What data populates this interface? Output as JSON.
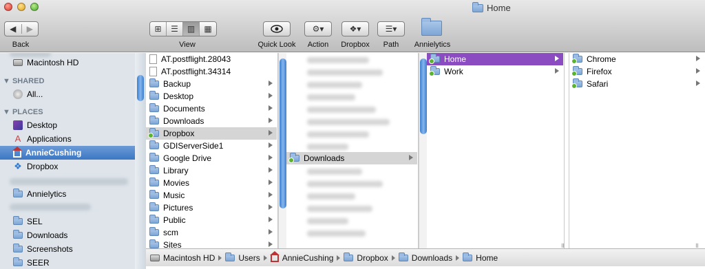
{
  "window": {
    "title": "Home"
  },
  "toolbar": {
    "back_label": "Back",
    "view_label": "View",
    "quicklook_label": "Quick Look",
    "action_label": "Action",
    "dropbox_label": "Dropbox",
    "path_label": "Path",
    "annielytics_label": "Annielytics"
  },
  "sidebar": {
    "devices": [
      {
        "label": "Macintosh HD",
        "icon": "hard-drive-icon"
      }
    ],
    "shared_heading": "SHARED",
    "shared": [
      {
        "label": "All...",
        "icon": "network-icon"
      }
    ],
    "places_heading": "PLACES",
    "places": [
      {
        "label": "Desktop",
        "icon": "desktop-icon"
      },
      {
        "label": "Applications",
        "icon": "applications-icon"
      },
      {
        "label": "AnnieCushing",
        "icon": "home-icon",
        "selected": true
      },
      {
        "label": "Dropbox",
        "icon": "dropbox-icon"
      }
    ],
    "folders": [
      {
        "label": "Annielytics"
      },
      {
        "label": "SEL"
      },
      {
        "label": "Downloads"
      },
      {
        "label": "Screenshots"
      },
      {
        "label": "SEER"
      }
    ]
  },
  "column1": [
    {
      "label": "AT.postflight.28043",
      "type": "file"
    },
    {
      "label": "AT.postflight.34314",
      "type": "file"
    },
    {
      "label": "Backup",
      "type": "folder"
    },
    {
      "label": "Desktop",
      "type": "folder"
    },
    {
      "label": "Documents",
      "type": "folder"
    },
    {
      "label": "Downloads",
      "type": "folder"
    },
    {
      "label": "Dropbox",
      "type": "folder",
      "highlight": "grey"
    },
    {
      "label": "GDIServerSide1",
      "type": "folder"
    },
    {
      "label": "Google Drive",
      "type": "folder"
    },
    {
      "label": "Library",
      "type": "folder"
    },
    {
      "label": "Movies",
      "type": "folder"
    },
    {
      "label": "Music",
      "type": "folder"
    },
    {
      "label": "Pictures",
      "type": "folder"
    },
    {
      "label": "Public",
      "type": "folder"
    },
    {
      "label": "scm",
      "type": "folder"
    },
    {
      "label": "Sites",
      "type": "folder"
    }
  ],
  "column2": {
    "selected_label": "Downloads"
  },
  "column3": [
    {
      "label": "Home",
      "highlight": "purple"
    },
    {
      "label": "Work"
    }
  ],
  "column4": [
    {
      "label": "Chrome"
    },
    {
      "label": "Firefox"
    },
    {
      "label": "Safari"
    }
  ],
  "pathbar": [
    "Macintosh HD",
    "Users",
    "AnnieCushing",
    "Dropbox",
    "Downloads",
    "Home"
  ],
  "colors": {
    "selection_blue": "#3c77c4",
    "purple_label": "#8b4cc2",
    "scroll_thumb": "#3c7ed0"
  }
}
